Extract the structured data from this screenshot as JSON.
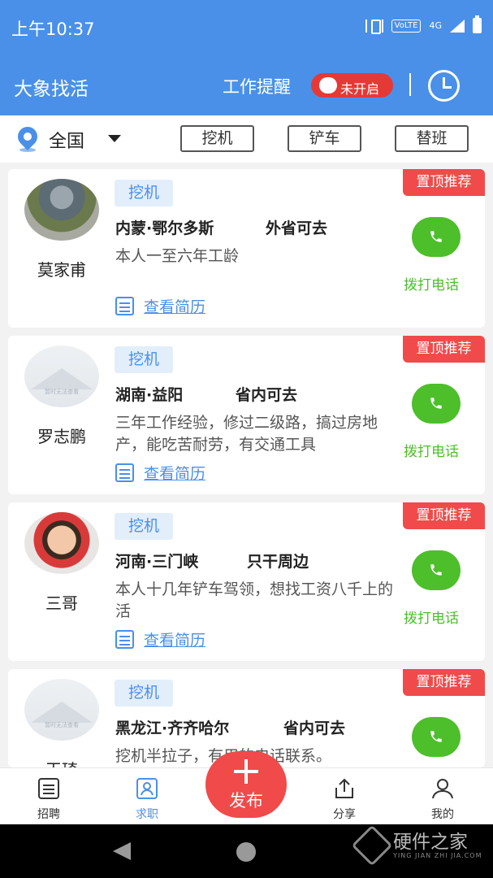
{
  "status_bar": {
    "time": "上午10:37",
    "network": "VoLTE",
    "network_gen": "4G"
  },
  "header": {
    "app_title": "大象找活",
    "remind_label": "工作提醒",
    "toggle_label": "未开启"
  },
  "filter": {
    "region": "全国",
    "buttons": [
      "挖机",
      "铲车",
      "替班"
    ]
  },
  "cards": [
    {
      "name": "莫家甫",
      "tag": "挖机",
      "location": "内蒙·鄂尔多斯",
      "scope": "外省可去",
      "desc": "本人一至六年工龄",
      "resume": "查看简历",
      "badge": "置顶推荐",
      "call": "拨打电话",
      "avatar": "photo"
    },
    {
      "name": "罗志鹏",
      "tag": "挖机",
      "location": "湖南·益阳",
      "scope": "省内可去",
      "desc": "三年工作经验，修过二级路，搞过房地产，能吃苦耐劳，有交通工具",
      "resume": "查看简历",
      "badge": "置顶推荐",
      "call": "拨打电话",
      "avatar": "placeholder",
      "avatar_text": "暂时无法查看"
    },
    {
      "name": "三哥",
      "tag": "挖机",
      "location": "河南·三门峡",
      "scope": "只干周边",
      "desc": "本人十几年铲车驾领，想找工资八千上的活",
      "resume": "查看简历",
      "badge": "置顶推荐",
      "call": "拨打电话",
      "avatar": "photo"
    },
    {
      "name": "天琦",
      "tag": "挖机",
      "location": "黑龙江·齐齐哈尔",
      "scope": "省内可去",
      "desc": "挖机半拉子，有用的电话联系。",
      "badge": "置顶推荐",
      "avatar": "placeholder",
      "avatar_text": "暂时无法查看"
    }
  ],
  "tabbar": {
    "tabs": [
      "招聘",
      "求职",
      "分享",
      "我的"
    ],
    "publish": "发布",
    "active": "求职"
  },
  "watermark": {
    "cn": "硬件之家",
    "en": "YING JIAN ZHI JIA.COM"
  },
  "colors": {
    "primary": "#4a90e8",
    "accent_red": "#f04a4a",
    "call_green": "#4cbf2a"
  }
}
